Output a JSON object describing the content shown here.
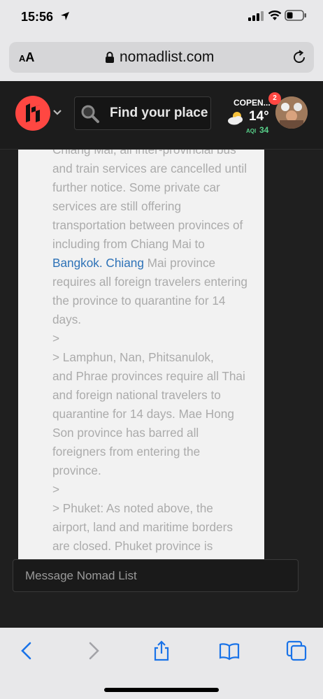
{
  "status_bar": {
    "time": "15:56"
  },
  "browser": {
    "text_size_small": "A",
    "text_size_big": "A",
    "url": "nomadlist.com"
  },
  "header": {
    "search_placeholder": "Find your place",
    "city": "COPEN...",
    "temperature": "14°",
    "aqi_label": "AQI",
    "aqi_value": "34",
    "notification_count": "2"
  },
  "content": {
    "lines": [
      "Chiang Mai, all inter-provincial bus",
      "and train services are cancelled until",
      "further notice. Some private car",
      "services are still offering",
      "transportation between provinces of",
      "including from Chiang Mai to"
    ],
    "link_text": "Bangkok. Chiang",
    "link_rest": " Mai province",
    "lines_after": [
      "requires all foreign travelers entering",
      "the province to quarantine for 14",
      "days.",
      ">",
      "> Lamphun, Nan, Phitsanulok,",
      "and Phrae provinces require all Thai",
      "and foreign national travelers to",
      "quarantine for 14 days. Mae Hong",
      "Son province has barred all",
      "foreigners from entering the",
      "province.",
      ">",
      "> Phuket: As noted above, the",
      "airport, land and maritime borders",
      "are closed. Phuket province is"
    ]
  },
  "message": {
    "placeholder": "Message Nomad List"
  },
  "colors": {
    "brand": "#ff4742",
    "link": "#2d72b7",
    "aqi": "#58d08a",
    "ios_blue": "#1a73e8"
  }
}
